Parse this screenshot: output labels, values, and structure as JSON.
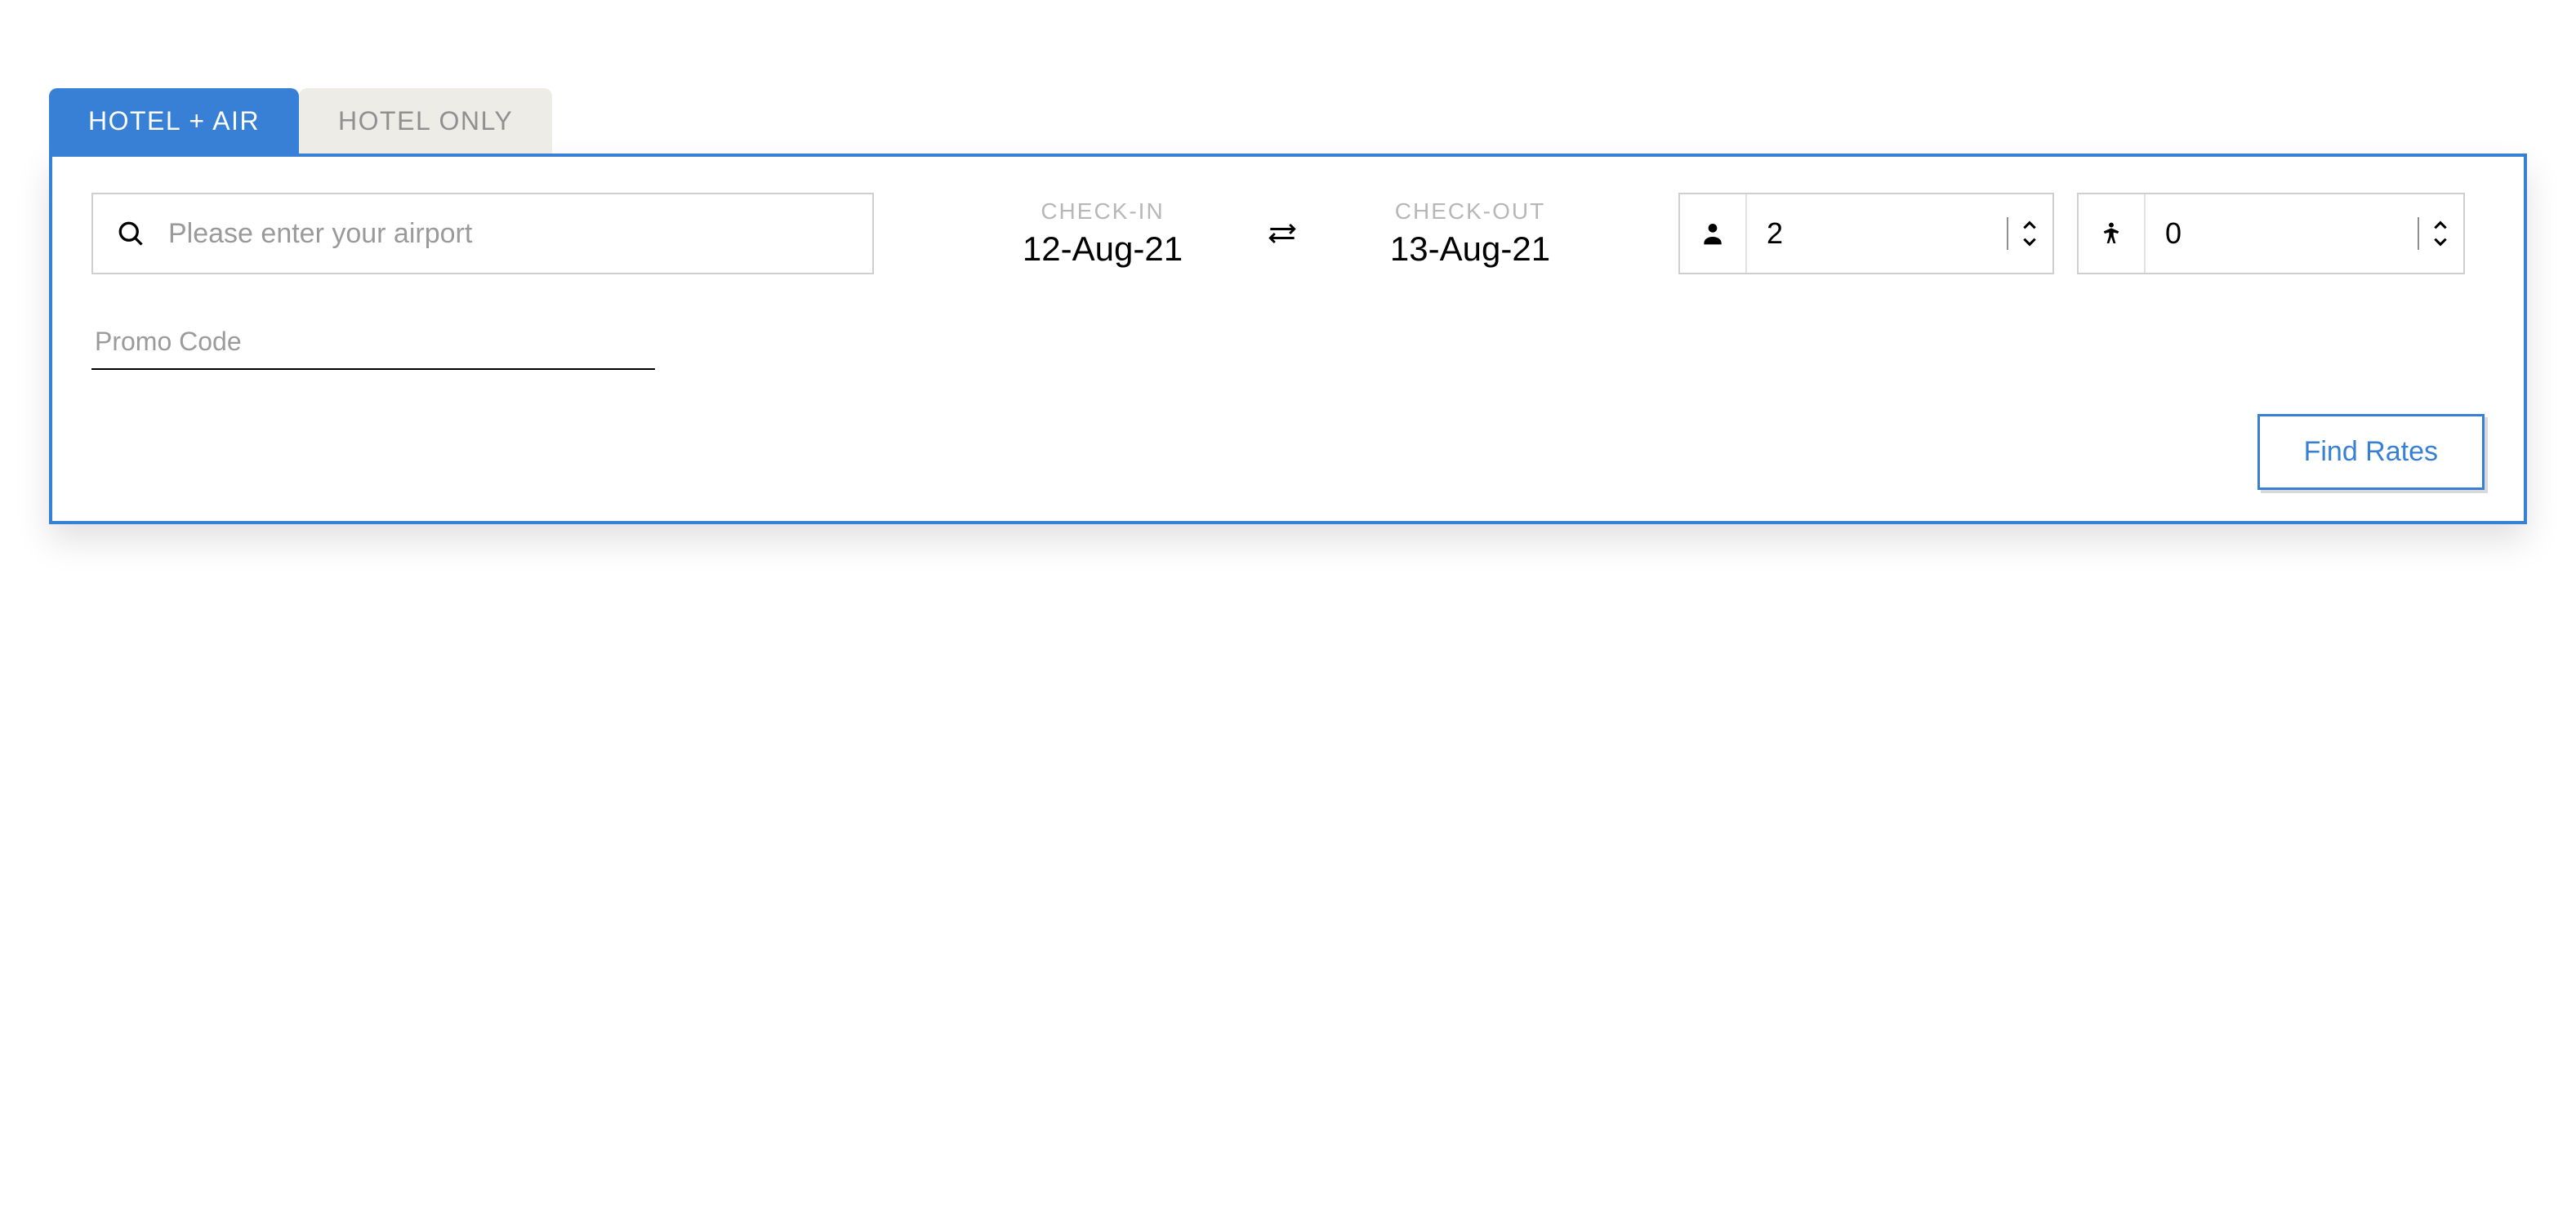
{
  "tabs": {
    "hotel_air": "HOTEL + AIR",
    "hotel_only": "HOTEL ONLY"
  },
  "search": {
    "airport_placeholder": "Please enter your airport",
    "airport_value": ""
  },
  "dates": {
    "checkin_label": "CHECK-IN",
    "checkin_value": "12-Aug-21",
    "checkout_label": "CHECK-OUT",
    "checkout_value": "13-Aug-21"
  },
  "guests": {
    "adults": "2",
    "children": "0"
  },
  "promo": {
    "placeholder": "Promo Code",
    "value": ""
  },
  "actions": {
    "find_rates": "Find Rates"
  },
  "colors": {
    "accent": "#3880D6"
  }
}
